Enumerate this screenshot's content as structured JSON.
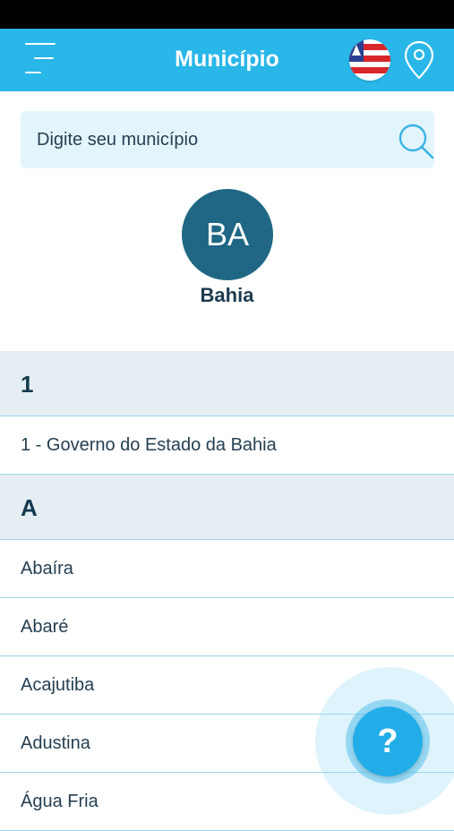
{
  "header": {
    "title": "Município",
    "brand_color": "#29b6e8",
    "menu_icon": "hamburger-menu-icon",
    "flag_icon": "bahia-flag-icon",
    "location_icon": "map-pin-icon"
  },
  "search": {
    "placeholder": "Digite seu município",
    "value": "",
    "icon": "search-icon"
  },
  "state": {
    "abbreviation": "BA",
    "name": "Bahia",
    "avatar_color": "#1f6784"
  },
  "list": {
    "sections": [
      {
        "letter": "1",
        "items": [
          "1 - Governo do Estado da Bahia"
        ]
      },
      {
        "letter": "A",
        "items": [
          "Abaíra",
          "Abaré",
          "Acajutiba",
          "Adustina",
          "Água Fria"
        ]
      }
    ]
  },
  "help": {
    "label": "?",
    "color": "#22ade8"
  }
}
